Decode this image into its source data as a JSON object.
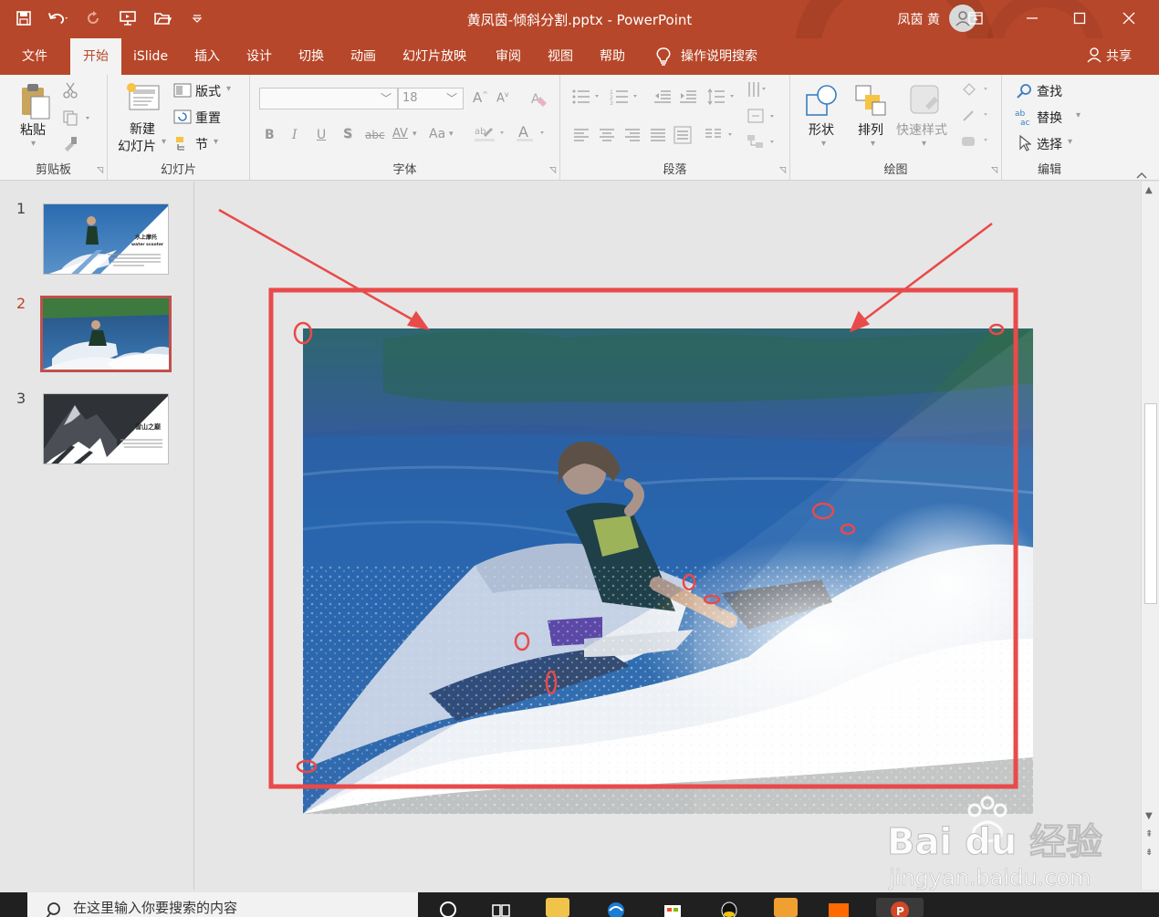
{
  "window": {
    "title": "黄凤茵-倾斜分割.pptx  -  PowerPoint",
    "user_name": "凤茵 黄",
    "brand_color": "#b7472a"
  },
  "tabs": [
    "文件",
    "开始",
    "iSlide",
    "插入",
    "设计",
    "切换",
    "动画",
    "幻灯片放映",
    "审阅",
    "视图",
    "帮助"
  ],
  "active_tab": "开始",
  "tell_me": "操作说明搜索",
  "share": "共享",
  "ribbon": {
    "clipboard": {
      "paste": "粘贴",
      "label": "剪贴板"
    },
    "slides": {
      "new_slide_1": "新建",
      "new_slide_2": "幻灯片",
      "layout": "版式",
      "reset": "重置",
      "section": "节",
      "label": "幻灯片"
    },
    "font": {
      "size": "18",
      "label": "字体",
      "bold": "B",
      "italic": "I",
      "underline": "U",
      "shadow": "S",
      "strike": "abc",
      "spacing": "AV",
      "case": "Aa"
    },
    "paragraph": {
      "label": "段落"
    },
    "drawing": {
      "shapes": "形状",
      "arrange": "排列",
      "quick_styles": "快速样式",
      "label": "绘图"
    },
    "editing": {
      "find": "查找",
      "replace": "替换",
      "select": "选择",
      "label": "编辑"
    }
  },
  "slides": [
    {
      "number": "1",
      "title_cn": "水上摩托",
      "title_en": "water scooter"
    },
    {
      "number": "2"
    },
    {
      "number": "3",
      "title_cn": "雪山之巅"
    }
  ],
  "selected_slide": "2",
  "taskbar": {
    "search_placeholder": "在这里输入你要搜索的内容"
  },
  "watermark": {
    "brand": "Bai du 经验",
    "url": "jingyan.baidu.com"
  },
  "icons": [
    "save-icon",
    "undo-icon",
    "redo-icon",
    "present-icon",
    "open-icon",
    "qat-more-icon",
    "lightbulb-icon",
    "person-icon",
    "minimize-icon",
    "maximize-icon",
    "close-icon",
    "ribbon-display-icon"
  ]
}
